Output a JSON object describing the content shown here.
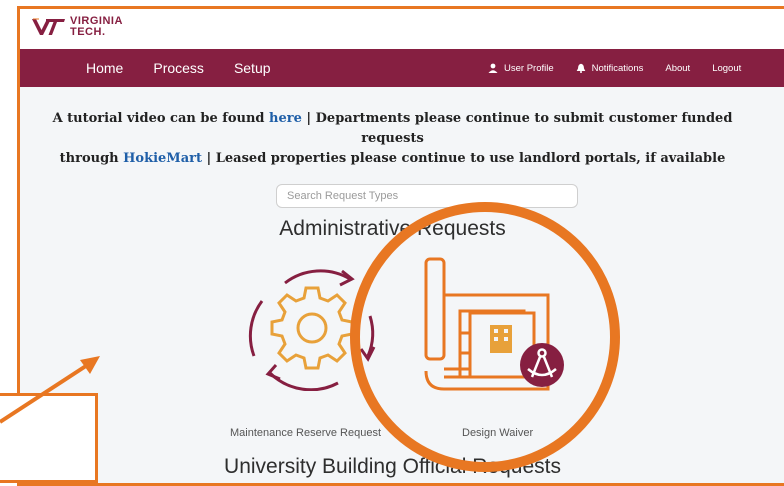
{
  "brand": {
    "line1": "VIRGINIA",
    "line2": "TECH.",
    "color": "#861f41"
  },
  "nav": {
    "home": "Home",
    "process": "Process",
    "setup": "Setup",
    "user_profile": "User Profile",
    "notifications": "Notifications",
    "about": "About",
    "logout": "Logout"
  },
  "banner": {
    "part1": "A tutorial video can be found ",
    "link1": "here",
    "part2": " | Departments please continue to submit customer funded requests",
    "part3": "through ",
    "link2": "HokieMart",
    "part4": " | Leased properties please continue to use landlord portals, if available"
  },
  "search": {
    "placeholder": "Search Request Types"
  },
  "sections": {
    "administrative": "Administrative Requests",
    "university": "University Building Official Requests"
  },
  "cards": [
    {
      "label": "Maintenance Reserve Request",
      "icon": "gear-cycle-icon"
    },
    {
      "label": "Design Waiver",
      "icon": "blueprint-icon"
    }
  ],
  "colors": {
    "maroon": "#861f41",
    "orange": "#e87722",
    "link": "#1f5fa8"
  }
}
